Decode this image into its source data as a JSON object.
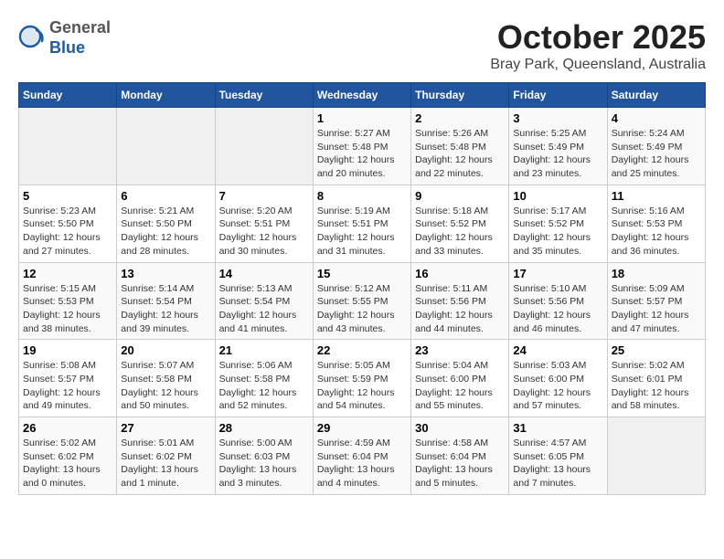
{
  "header": {
    "logo_general": "General",
    "logo_blue": "Blue",
    "month_title": "October 2025",
    "location": "Bray Park, Queensland, Australia"
  },
  "days_of_week": [
    "Sunday",
    "Monday",
    "Tuesday",
    "Wednesday",
    "Thursday",
    "Friday",
    "Saturday"
  ],
  "weeks": [
    [
      {
        "day": "",
        "info": ""
      },
      {
        "day": "",
        "info": ""
      },
      {
        "day": "",
        "info": ""
      },
      {
        "day": "1",
        "info": "Sunrise: 5:27 AM\nSunset: 5:48 PM\nDaylight: 12 hours\nand 20 minutes."
      },
      {
        "day": "2",
        "info": "Sunrise: 5:26 AM\nSunset: 5:48 PM\nDaylight: 12 hours\nand 22 minutes."
      },
      {
        "day": "3",
        "info": "Sunrise: 5:25 AM\nSunset: 5:49 PM\nDaylight: 12 hours\nand 23 minutes."
      },
      {
        "day": "4",
        "info": "Sunrise: 5:24 AM\nSunset: 5:49 PM\nDaylight: 12 hours\nand 25 minutes."
      }
    ],
    [
      {
        "day": "5",
        "info": "Sunrise: 5:23 AM\nSunset: 5:50 PM\nDaylight: 12 hours\nand 27 minutes."
      },
      {
        "day": "6",
        "info": "Sunrise: 5:21 AM\nSunset: 5:50 PM\nDaylight: 12 hours\nand 28 minutes."
      },
      {
        "day": "7",
        "info": "Sunrise: 5:20 AM\nSunset: 5:51 PM\nDaylight: 12 hours\nand 30 minutes."
      },
      {
        "day": "8",
        "info": "Sunrise: 5:19 AM\nSunset: 5:51 PM\nDaylight: 12 hours\nand 31 minutes."
      },
      {
        "day": "9",
        "info": "Sunrise: 5:18 AM\nSunset: 5:52 PM\nDaylight: 12 hours\nand 33 minutes."
      },
      {
        "day": "10",
        "info": "Sunrise: 5:17 AM\nSunset: 5:52 PM\nDaylight: 12 hours\nand 35 minutes."
      },
      {
        "day": "11",
        "info": "Sunrise: 5:16 AM\nSunset: 5:53 PM\nDaylight: 12 hours\nand 36 minutes."
      }
    ],
    [
      {
        "day": "12",
        "info": "Sunrise: 5:15 AM\nSunset: 5:53 PM\nDaylight: 12 hours\nand 38 minutes."
      },
      {
        "day": "13",
        "info": "Sunrise: 5:14 AM\nSunset: 5:54 PM\nDaylight: 12 hours\nand 39 minutes."
      },
      {
        "day": "14",
        "info": "Sunrise: 5:13 AM\nSunset: 5:54 PM\nDaylight: 12 hours\nand 41 minutes."
      },
      {
        "day": "15",
        "info": "Sunrise: 5:12 AM\nSunset: 5:55 PM\nDaylight: 12 hours\nand 43 minutes."
      },
      {
        "day": "16",
        "info": "Sunrise: 5:11 AM\nSunset: 5:56 PM\nDaylight: 12 hours\nand 44 minutes."
      },
      {
        "day": "17",
        "info": "Sunrise: 5:10 AM\nSunset: 5:56 PM\nDaylight: 12 hours\nand 46 minutes."
      },
      {
        "day": "18",
        "info": "Sunrise: 5:09 AM\nSunset: 5:57 PM\nDaylight: 12 hours\nand 47 minutes."
      }
    ],
    [
      {
        "day": "19",
        "info": "Sunrise: 5:08 AM\nSunset: 5:57 PM\nDaylight: 12 hours\nand 49 minutes."
      },
      {
        "day": "20",
        "info": "Sunrise: 5:07 AM\nSunset: 5:58 PM\nDaylight: 12 hours\nand 50 minutes."
      },
      {
        "day": "21",
        "info": "Sunrise: 5:06 AM\nSunset: 5:58 PM\nDaylight: 12 hours\nand 52 minutes."
      },
      {
        "day": "22",
        "info": "Sunrise: 5:05 AM\nSunset: 5:59 PM\nDaylight: 12 hours\nand 54 minutes."
      },
      {
        "day": "23",
        "info": "Sunrise: 5:04 AM\nSunset: 6:00 PM\nDaylight: 12 hours\nand 55 minutes."
      },
      {
        "day": "24",
        "info": "Sunrise: 5:03 AM\nSunset: 6:00 PM\nDaylight: 12 hours\nand 57 minutes."
      },
      {
        "day": "25",
        "info": "Sunrise: 5:02 AM\nSunset: 6:01 PM\nDaylight: 12 hours\nand 58 minutes."
      }
    ],
    [
      {
        "day": "26",
        "info": "Sunrise: 5:02 AM\nSunset: 6:02 PM\nDaylight: 13 hours\nand 0 minutes."
      },
      {
        "day": "27",
        "info": "Sunrise: 5:01 AM\nSunset: 6:02 PM\nDaylight: 13 hours\nand 1 minute."
      },
      {
        "day": "28",
        "info": "Sunrise: 5:00 AM\nSunset: 6:03 PM\nDaylight: 13 hours\nand 3 minutes."
      },
      {
        "day": "29",
        "info": "Sunrise: 4:59 AM\nSunset: 6:04 PM\nDaylight: 13 hours\nand 4 minutes."
      },
      {
        "day": "30",
        "info": "Sunrise: 4:58 AM\nSunset: 6:04 PM\nDaylight: 13 hours\nand 5 minutes."
      },
      {
        "day": "31",
        "info": "Sunrise: 4:57 AM\nSunset: 6:05 PM\nDaylight: 13 hours\nand 7 minutes."
      },
      {
        "day": "",
        "info": ""
      }
    ]
  ]
}
